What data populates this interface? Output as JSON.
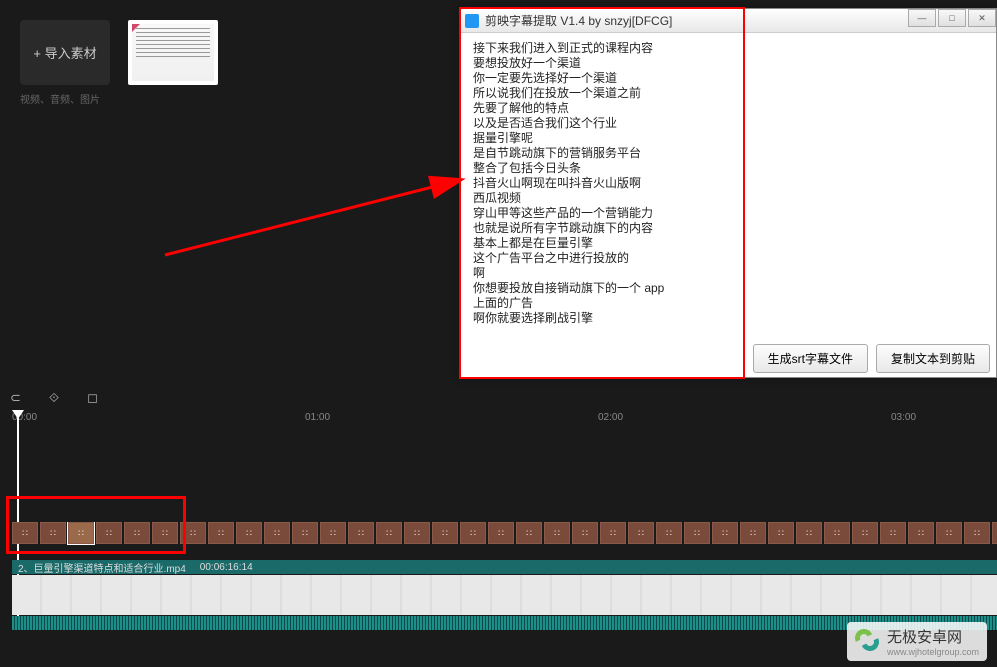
{
  "media": {
    "import_label": "+  导入素材",
    "import_sub": "视频、音频、图片"
  },
  "dialog": {
    "title": "剪映字幕提取 V1.4 by snzyj[DFCG]",
    "lines": [
      "接下来我们进入到正式的课程内容",
      "要想投放好一个渠道",
      "你一定要先选择好一个渠道",
      "所以说我们在投放一个渠道之前",
      "先要了解他的特点",
      "以及是否适合我们这个行业",
      "据量引擎呢",
      "是自节跳动旗下的营销服务平台",
      "整合了包括今日头条",
      "抖音火山啊现在叫抖音火山版啊",
      "西瓜视频",
      "穿山甲等这些产品的一个营销能力",
      "也就是说所有字节跳动旗下的内容",
      "基本上都是在巨量引擎",
      "这个广告平台之中进行投放的",
      "啊",
      "你想要投放自接销动旗下的一个 app",
      "上面的广告",
      "啊你就要选择刷战引擎"
    ],
    "btn_srt": "生成srt字幕文件",
    "btn_copy": "复制文本到剪贴"
  },
  "ruler": {
    "t0": "00:00",
    "t1": "01:00",
    "t2": "02:00",
    "t3": "03:00"
  },
  "clip": {
    "name": "2、巨量引擎渠道特点和适合行业.mp4",
    "duration": "00:06:16:14"
  },
  "watermark": {
    "name": "无极安卓网",
    "url": "www.wjhotelgroup.com"
  }
}
